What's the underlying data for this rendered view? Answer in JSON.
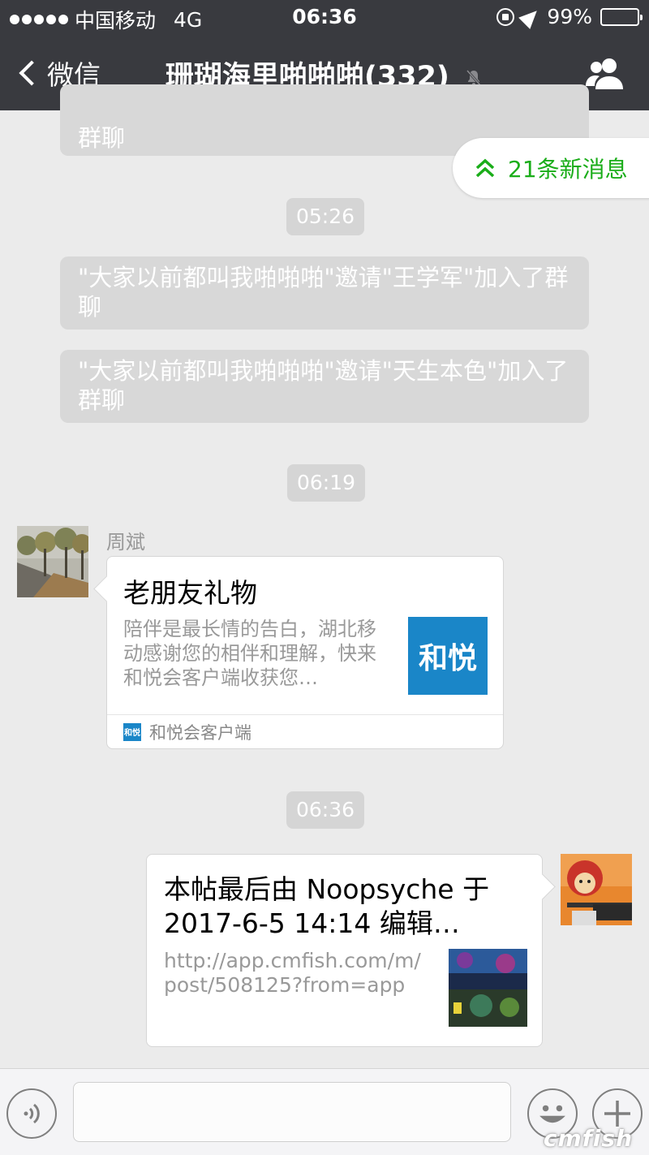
{
  "status_bar": {
    "carrier": "中国移动",
    "network": "4G",
    "time": "06:36",
    "battery": "99%",
    "battery_level": 0.99
  },
  "nav": {
    "back_label": "微信",
    "title": "珊瑚海里啪啪啪(332)"
  },
  "new_messages_badge": "21条新消息",
  "messages": {
    "sys_partial": "群聊",
    "time_1": "05:26",
    "sys_1": "\"大家以前都叫我啪啪啪\"邀请\"王学军\"加入了群聊",
    "sys_2": "\"大家以前都叫我啪啪啪\"邀请\"天生本色\"加入了群聊",
    "time_2": "06:19",
    "sender_name": "周斌",
    "card_1": {
      "title": "老朋友礼物",
      "desc": "陪伴是最长情的告白，湖北移动感谢您的相伴和理解，快来和悦会客户端收获您…",
      "thumb_text": "和悦",
      "source_logo": "和悦",
      "source": "和悦会客户端"
    },
    "time_3": "06:36",
    "card_2": {
      "title": "本帖最后由 Noopsyche 于 2017-6-5 14:14 编辑…",
      "url": "http://app.cmfish.com/m/post/508125?from=app"
    }
  },
  "input_bar": {
    "placeholder": ""
  },
  "watermark": "cmfish",
  "colors": {
    "nav_bg": "#393a3f",
    "chat_bg": "#ebebeb",
    "accent_green": "#1aad19",
    "brand_blue": "#1a86c8"
  }
}
